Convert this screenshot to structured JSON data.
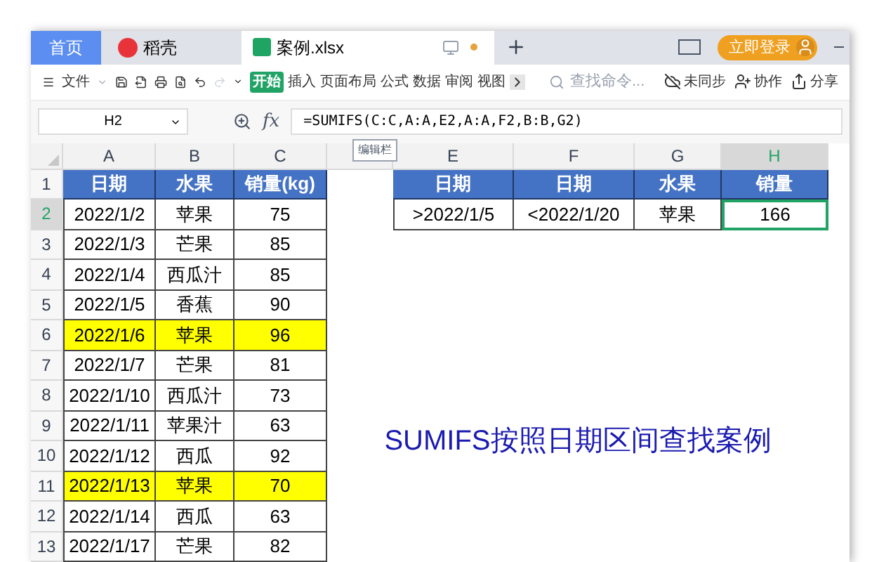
{
  "tabs": [
    {
      "kind": "home",
      "label": "首页",
      "selected": false
    },
    {
      "kind": "docer",
      "label": "稻壳",
      "selected": false
    },
    {
      "kind": "sheet",
      "label": "案例.xlsx",
      "selected": true
    }
  ],
  "login_button": "立即登录",
  "toolbar": {
    "file_menu": "文件",
    "ribbon_tabs": [
      {
        "label": "开始",
        "selected": true
      },
      {
        "label": "插入",
        "selected": false
      },
      {
        "label": "页面布局",
        "selected": false
      },
      {
        "label": "公式",
        "selected": false
      },
      {
        "label": "数据",
        "selected": false
      },
      {
        "label": "审阅",
        "selected": false
      },
      {
        "label": "视图",
        "selected": false
      }
    ],
    "search": {
      "placeholder": "查找命令..."
    },
    "actions": [
      "未同步",
      "协作",
      "分享"
    ]
  },
  "formula_bar": {
    "name_box": "H2",
    "fx": "fx",
    "formula": "=SUMIFS(C:C,A:A,E2,A:A,F2,B:B,G2)",
    "tooltip": "编辑栏"
  },
  "columns": [
    {
      "label": "A",
      "selected": false
    },
    {
      "label": "B",
      "selected": false
    },
    {
      "label": "C",
      "selected": false
    },
    {
      "selected": false
    },
    {
      "label": "E",
      "selected": false
    },
    {
      "label": "F",
      "selected": false
    },
    {
      "label": "G",
      "selected": false
    },
    {
      "label": "H",
      "selected": true
    }
  ],
  "row_numbers": [
    {
      "label": "1",
      "selected": false
    },
    {
      "label": "2",
      "selected": true
    },
    {
      "label": "3",
      "selected": false
    },
    {
      "label": "4",
      "selected": false
    },
    {
      "label": "5",
      "selected": false
    },
    {
      "label": "6",
      "selected": false
    },
    {
      "label": "7",
      "selected": false
    },
    {
      "label": "8",
      "selected": false
    },
    {
      "label": "9",
      "selected": false
    },
    {
      "label": "10",
      "selected": false
    },
    {
      "label": "11",
      "selected": false
    },
    {
      "label": "12",
      "selected": false
    },
    {
      "label": "13",
      "selected": false
    }
  ],
  "data_table": {
    "headers": [
      "日期",
      "水果",
      "销量(kg)"
    ],
    "rows": [
      {
        "cells": [
          "2022/1/2",
          "苹果",
          "75"
        ],
        "highlighted": false
      },
      {
        "cells": [
          "2022/1/3",
          "芒果",
          "85"
        ],
        "highlighted": false
      },
      {
        "cells": [
          "2022/1/4",
          "西瓜汁",
          "85"
        ],
        "highlighted": false
      },
      {
        "cells": [
          "2022/1/5",
          "香蕉",
          "90"
        ],
        "highlighted": false
      },
      {
        "cells": [
          "2022/1/6",
          "苹果",
          "96"
        ],
        "highlighted": true
      },
      {
        "cells": [
          "2022/1/7",
          "芒果",
          "81"
        ],
        "highlighted": false
      },
      {
        "cells": [
          "2022/1/10",
          "西瓜汁",
          "73"
        ],
        "highlighted": false
      },
      {
        "cells": [
          "2022/1/11",
          "苹果汁",
          "63"
        ],
        "highlighted": false
      },
      {
        "cells": [
          "2022/1/12",
          "西瓜",
          "92"
        ],
        "highlighted": false
      },
      {
        "cells": [
          "2022/1/13",
          "苹果",
          "70"
        ],
        "highlighted": true
      },
      {
        "cells": [
          "2022/1/14",
          "西瓜",
          "63"
        ],
        "highlighted": false
      },
      {
        "cells": [
          "2022/1/17",
          "芒果",
          "82"
        ],
        "highlighted": false
      }
    ]
  },
  "criteria_table": {
    "headers": [
      "日期",
      "日期",
      "水果",
      "销量"
    ],
    "cells": [
      {
        "text": ">2022/1/5",
        "selected": false
      },
      {
        "text": "<2022/1/20",
        "selected": false
      },
      {
        "text": "苹果",
        "selected": false
      },
      {
        "text": "166",
        "selected": true
      }
    ]
  },
  "caption": "SUMIFS按照日期区间查找案例"
}
